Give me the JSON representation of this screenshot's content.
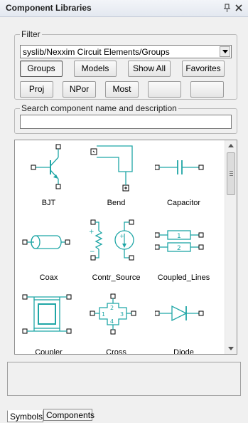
{
  "panel": {
    "title": "Component Libraries",
    "pin_icon": "pin-icon",
    "close_icon": "close-icon"
  },
  "filter": {
    "legend": "Filter",
    "selected_library": "syslib/Nexxim Circuit Elements/Groups",
    "buttons_row1": [
      "Groups",
      "Models",
      "Show All",
      "Favorites"
    ],
    "buttons_row2": [
      "Proj",
      "NPor",
      "Most",
      "",
      ""
    ],
    "active_button": "Groups"
  },
  "search": {
    "legend": "Search component name and description",
    "value": ""
  },
  "components": [
    {
      "name": "BJT",
      "icon": "bjt-symbol-icon"
    },
    {
      "name": "Bend",
      "icon": "bend-symbol-icon"
    },
    {
      "name": "Capacitor",
      "icon": "capacitor-symbol-icon"
    },
    {
      "name": "Coax",
      "icon": "coax-symbol-icon"
    },
    {
      "name": "Contr_Source",
      "icon": "controlled-source-symbol-icon"
    },
    {
      "name": "Coupled_Lines",
      "icon": "coupled-lines-symbol-icon"
    },
    {
      "name": "Coupler",
      "icon": "coupler-symbol-icon"
    },
    {
      "name": "Cross",
      "icon": "cross-symbol-icon"
    },
    {
      "name": "Diode",
      "icon": "diode-symbol-icon"
    }
  ],
  "symbol_pin_labels": {
    "coupled_lines": [
      "1",
      "2"
    ],
    "cross": [
      "1",
      "2",
      "3",
      "4"
    ],
    "source": [
      "+",
      "−"
    ]
  },
  "tabs": [
    "Symbols",
    "Components"
  ],
  "active_tab": "Symbols",
  "colors": {
    "symbol": "#1fa6a6",
    "pin": "#000000"
  }
}
